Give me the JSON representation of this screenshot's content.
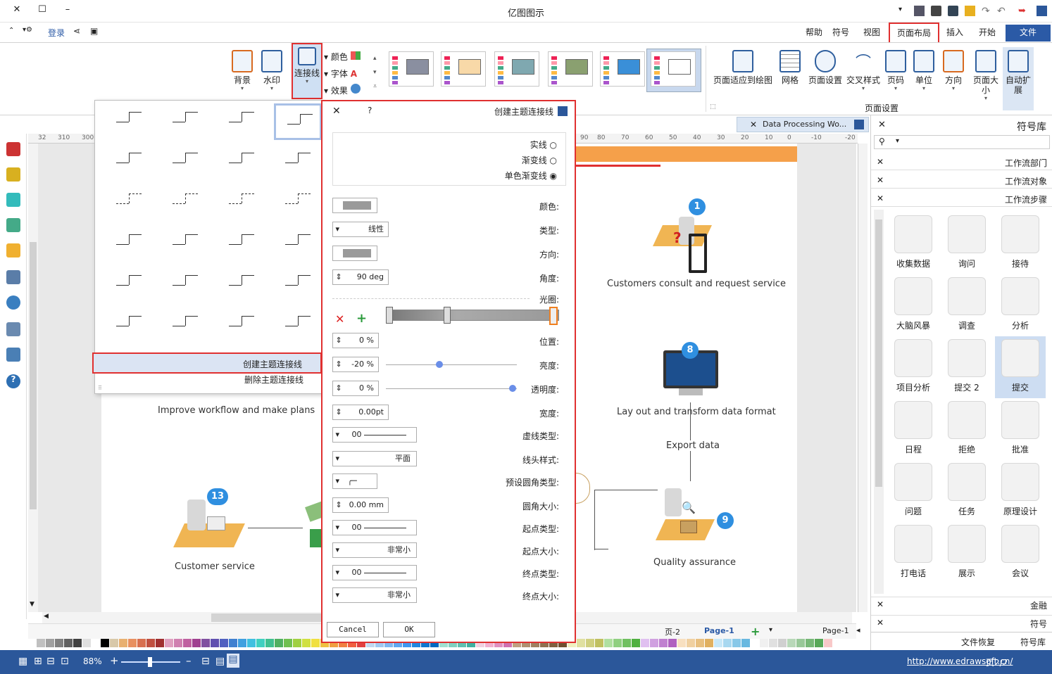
{
  "app": {
    "title": "亿图图示"
  },
  "menu": {
    "tabs": [
      "文件",
      "开始",
      "插入",
      "页面布局",
      "视图",
      "符号",
      "帮助"
    ],
    "active": "页面布局",
    "login": "登录"
  },
  "ribbon": {
    "page_setup": [
      "自动扩展",
      "页面大小",
      "方向",
      "单位",
      "页码",
      "交叉样式",
      "页面设置",
      "网格",
      "页面适应到绘图"
    ],
    "page_setup_group": "页面设置",
    "connector": "连接线",
    "watermark": "水印",
    "background": "背景",
    "small_buttons": [
      "颜色",
      "字体",
      "效果"
    ]
  },
  "connector_menu": {
    "create": "创建主题连接线",
    "delete": "删除主题连接线"
  },
  "dialog": {
    "title": "创建主题连接线",
    "help": "?",
    "line_types": [
      "实线",
      "渐变线",
      "单色渐变线"
    ],
    "labels": {
      "color": "颜色:",
      "type": "类型:",
      "direction": "方向:",
      "angle": "角度:",
      "aperture": "光圈:",
      "position": "位置:",
      "brightness": "亮度:",
      "transparency": "透明度:",
      "width": "宽度:",
      "dash": "虚线类型:",
      "cap": "线头样式:",
      "corner_type": "预设圆角类型:",
      "corner_size": "圆角大小:",
      "begin_type": "起点类型:",
      "begin_size": "起点大小:",
      "end_type": "终点类型:",
      "end_size": "终点大小:"
    },
    "values": {
      "type": "线性",
      "angle": "90 deg",
      "position": "0 %",
      "brightness": "-20 %",
      "transparency": "0 %",
      "width": "0.00pt",
      "dash": "00",
      "cap": "平面",
      "corner_size": "0.00 mm",
      "begin_type": "00",
      "begin_size": "非常小",
      "end_type": "00",
      "end_size": "非常小"
    },
    "ok": "OK",
    "cancel": "Cancel",
    "brightness_level": 0.41,
    "transparency_level": 0.97
  },
  "doc": {
    "tab": "Data Processing Wo...",
    "ruler_ticks": [
      "-20",
      "-10",
      "0",
      "10",
      "20",
      "30",
      "40",
      "50",
      "60",
      "70",
      "80",
      "90",
      "310",
      "300",
      "32"
    ],
    "nodes": {
      "n1": "Customers consult and request service",
      "n8": "Lay out and transform data  format",
      "n9": "Quality assurance",
      "n13": "Customer service",
      "plans": "Improve workflow and make plans",
      "export": "Export data"
    },
    "badges": [
      "1",
      "8",
      "9",
      "13"
    ],
    "pages": [
      "Page-1",
      "Page-1",
      "页-2"
    ]
  },
  "library": {
    "title": "符号库",
    "categories": [
      "工作流部门",
      "工作流对象",
      "工作流步骤"
    ],
    "symbols": [
      "接待",
      "询问",
      "收集数据",
      "分析",
      "调查",
      "大脑风暴",
      "提交",
      "提交 2",
      "项目分析",
      "批准",
      "拒绝",
      "日程",
      "原理设计",
      "任务",
      "问题",
      "会议",
      "展示",
      "打电话"
    ],
    "bottom_categories": [
      "金融",
      "符号"
    ],
    "bottom_tabs": [
      "符号库",
      "文件恢复"
    ]
  },
  "status": {
    "url": "http://www.edrawsoft.cn/",
    "page": "页2/2",
    "zoom": "88%",
    "zoom_level": 0.45
  },
  "colors": {
    "accent": "#2B579A",
    "highlight": "#E03030",
    "orange": "#F5A04A"
  }
}
